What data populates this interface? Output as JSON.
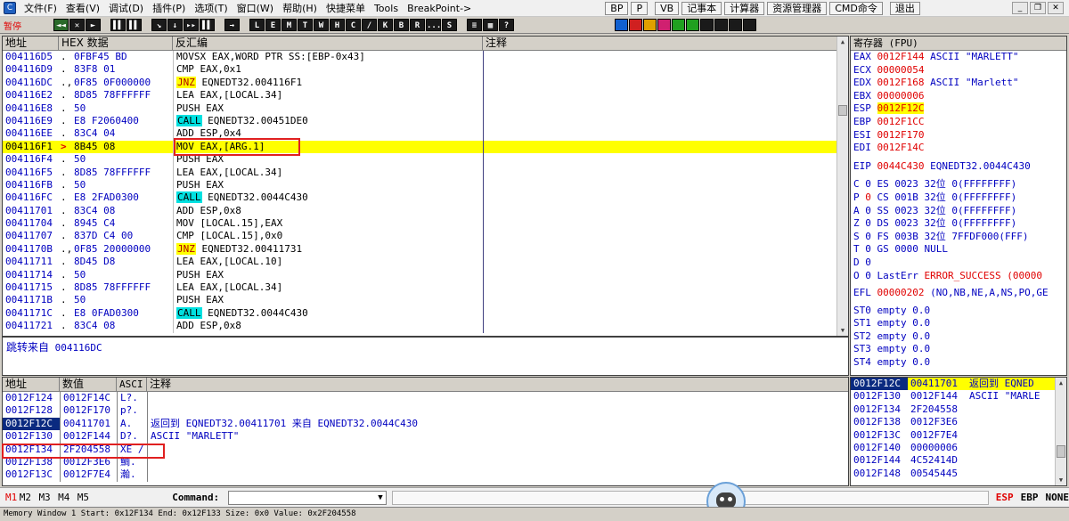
{
  "menu": {
    "items": [
      "文件(F)",
      "查看(V)",
      "调试(D)",
      "插件(P)",
      "选项(T)",
      "窗口(W)",
      "帮助(H)",
      "快捷菜单",
      "Tools",
      "BreakPoint->"
    ],
    "right_buttons": [
      "BP",
      "P",
      "VB",
      "记事本",
      "计算器",
      "资源管理器",
      "CMD命令",
      "退出"
    ]
  },
  "toolbar": {
    "status": "暂停",
    "group1": [
      "◄◄",
      "✕",
      "►"
    ],
    "group2": [
      "▌▌",
      "▌▌",
      "▌▌"
    ],
    "group3": [
      "↘",
      "↓",
      "▸▸"
    ],
    "group4": [
      "→"
    ],
    "letters": [
      "L",
      "E",
      "M",
      "T",
      "W",
      "H",
      "C",
      "/",
      "K",
      "B",
      "R",
      "...",
      "S"
    ],
    "group5": [
      "≡",
      "▦",
      "?"
    ]
  },
  "disasm": {
    "headers": {
      "addr": "地址",
      "hex": "HEX 数据",
      "dis": "反汇编",
      "comment": "注释"
    },
    "rows": [
      {
        "addr": "004116D5",
        "mk": ".",
        "hex": "0FBF45 BD",
        "dis": "MOVSX EAX,WORD PTR SS:[EBP-0x43]",
        "kw": ""
      },
      {
        "addr": "004116D9",
        "mk": ".",
        "hex": "83F8 01",
        "dis": "CMP EAX,0x1",
        "kw": ""
      },
      {
        "addr": "004116DC",
        "mk": ".,",
        "hex": "0F85 0F000000",
        "dis": " EQNEDT32.004116F1",
        "kw": "JNZ"
      },
      {
        "addr": "004116E2",
        "mk": ".",
        "hex": "8D85 78FFFFFF",
        "dis": "LEA EAX,[LOCAL.34]",
        "kw": ""
      },
      {
        "addr": "004116E8",
        "mk": ".",
        "hex": "50",
        "dis": "PUSH EAX",
        "kw": ""
      },
      {
        "addr": "004116E9",
        "mk": ".",
        "hex": "E8 F2060400",
        "dis": " EQNEDT32.00451DE0",
        "kw": "CALL"
      },
      {
        "addr": "004116EE",
        "mk": ".",
        "hex": "83C4 04",
        "dis": "ADD ESP,0x4",
        "kw": ""
      },
      {
        "addr": "004116F1",
        "mk": ">",
        "hex": "8B45 08",
        "dis": "MOV EAX,[ARG.1]",
        "kw": "",
        "sel": true
      },
      {
        "addr": "004116F4",
        "mk": ".",
        "hex": "50",
        "dis": "PUSH EAX",
        "kw": ""
      },
      {
        "addr": "004116F5",
        "mk": ".",
        "hex": "8D85 78FFFFFF",
        "dis": "LEA EAX,[LOCAL.34]",
        "kw": ""
      },
      {
        "addr": "004116FB",
        "mk": ".",
        "hex": "50",
        "dis": "PUSH EAX",
        "kw": ""
      },
      {
        "addr": "004116FC",
        "mk": ".",
        "hex": "E8 2FAD0300",
        "dis": " EQNEDT32.0044C430",
        "kw": "CALL"
      },
      {
        "addr": "00411701",
        "mk": ".",
        "hex": "83C4 08",
        "dis": "ADD ESP,0x8",
        "kw": ""
      },
      {
        "addr": "00411704",
        "mk": ".",
        "hex": "8945 C4",
        "dis": "MOV [LOCAL.15],EAX",
        "kw": ""
      },
      {
        "addr": "00411707",
        "mk": ".",
        "hex": "837D C4 00",
        "dis": "CMP [LOCAL.15],0x0",
        "kw": ""
      },
      {
        "addr": "0041170B",
        "mk": ".,",
        "hex": "0F85 20000000",
        "dis": " EQNEDT32.00411731",
        "kw": "JNZ"
      },
      {
        "addr": "00411711",
        "mk": ".",
        "hex": "8D45 D8",
        "dis": "LEA EAX,[LOCAL.10]",
        "kw": ""
      },
      {
        "addr": "00411714",
        "mk": ".",
        "hex": "50",
        "dis": "PUSH EAX",
        "kw": ""
      },
      {
        "addr": "00411715",
        "mk": ".",
        "hex": "8D85 78FFFFFF",
        "dis": "LEA EAX,[LOCAL.34]",
        "kw": ""
      },
      {
        "addr": "0041171B",
        "mk": ".",
        "hex": "50",
        "dis": "PUSH EAX",
        "kw": ""
      },
      {
        "addr": "0041171C",
        "mk": ".",
        "hex": "E8 0FAD0300",
        "dis": " EQNEDT32.0044C430",
        "kw": "CALL"
      },
      {
        "addr": "00411721",
        "mk": ".",
        "hex": "83C4 08",
        "dis": "ADD ESP,0x8",
        "kw": ""
      }
    ]
  },
  "info": {
    "label": "跳转来自",
    "value": "004116DC"
  },
  "registers": {
    "title": "寄存器 (FPU)",
    "gp": [
      {
        "name": "EAX",
        "val": "0012F144",
        "note": "ASCII \"MARLETT\""
      },
      {
        "name": "ECX",
        "val": "00000054",
        "note": ""
      },
      {
        "name": "EDX",
        "val": "0012F168",
        "note": "ASCII \"Marlett\""
      },
      {
        "name": "EBX",
        "val": "00000006",
        "note": ""
      },
      {
        "name": "ESP",
        "val": "0012F12C",
        "note": "",
        "hl": true
      },
      {
        "name": "EBP",
        "val": "0012F1CC",
        "note": ""
      },
      {
        "name": "ESI",
        "val": "0012F170",
        "note": ""
      },
      {
        "name": "EDI",
        "val": "0012F14C",
        "note": ""
      }
    ],
    "eip": {
      "name": "EIP",
      "val": "0044C430",
      "note": "EQNEDT32.0044C430"
    },
    "flags": [
      {
        "f": "C",
        "v": "0",
        "seg": "ES",
        "sv": "0023",
        "bits": "32位",
        "base": "0(FFFFFFFF)"
      },
      {
        "f": "P",
        "v": "0",
        "seg": "CS",
        "sv": "001B",
        "bits": "32位",
        "base": "0(FFFFFFFF)",
        "red": true
      },
      {
        "f": "A",
        "v": "0",
        "seg": "SS",
        "sv": "0023",
        "bits": "32位",
        "base": "0(FFFFFFFF)"
      },
      {
        "f": "Z",
        "v": "0",
        "seg": "DS",
        "sv": "0023",
        "bits": "32位",
        "base": "0(FFFFFFFF)"
      },
      {
        "f": "S",
        "v": "0",
        "seg": "FS",
        "sv": "003B",
        "bits": "32位",
        "base": "7FFDF000(FFF)"
      },
      {
        "f": "T",
        "v": "0",
        "seg": "GS",
        "sv": "0000",
        "bits": "NULL",
        "base": ""
      },
      {
        "f": "D",
        "v": "0",
        "seg": "",
        "sv": "",
        "bits": "",
        "base": ""
      },
      {
        "f": "O",
        "v": "0",
        "seg": "LastErr",
        "sv": "ERROR_SUCCESS (00000",
        "bits": "",
        "base": ""
      }
    ],
    "efl": {
      "name": "EFL",
      "val": "00000202",
      "note": "(NO,NB,NE,A,NS,PO,GE"
    },
    "fpu": [
      "ST0 empty 0.0",
      "ST1 empty 0.0",
      "ST2 empty 0.0",
      "ST3 empty 0.0",
      "ST4 empty 0.0"
    ]
  },
  "dump": {
    "headers": {
      "addr": "地址",
      "val": "数值",
      "ascii": "ASCI",
      "comment": "注释"
    },
    "rows": [
      {
        "addr": "0012F124",
        "val": "0012F14C",
        "ascii": "L?.",
        "comment": ""
      },
      {
        "addr": "0012F128",
        "val": "0012F170",
        "ascii": "p?.",
        "comment": ""
      },
      {
        "addr": "0012F12C",
        "val": "00411701",
        "ascii": "A.",
        "comment": "返回到 EQNEDT32.00411701 来自 EQNEDT32.0044C430",
        "sel": true
      },
      {
        "addr": "0012F130",
        "val": "0012F144",
        "ascii": "D?.",
        "comment": "ASCII \"MARLETT\""
      },
      {
        "addr": "0012F134",
        "val": "2F204558",
        "ascii": "XE /",
        "comment": ""
      },
      {
        "addr": "0012F138",
        "val": "0012F3E6",
        "ascii": "鯛.",
        "comment": ""
      },
      {
        "addr": "0012F13C",
        "val": "0012F7E4",
        "ascii": "瀚.",
        "comment": ""
      }
    ]
  },
  "stack": {
    "top": {
      "addr": "0012F12C",
      "val": "00411701",
      "note": "返回到 EQNED"
    },
    "rows": [
      {
        "addr": "0012F130",
        "val": "0012F144",
        "note": "ASCII \"MARLE"
      },
      {
        "addr": "0012F134",
        "val": "2F204558",
        "note": ""
      },
      {
        "addr": "0012F138",
        "val": "0012F3E6",
        "note": ""
      },
      {
        "addr": "0012F13C",
        "val": "0012F7E4",
        "note": ""
      },
      {
        "addr": "0012F140",
        "val": "00000006",
        "note": ""
      },
      {
        "addr": "0012F144",
        "val": "4C52414D",
        "note": ""
      },
      {
        "addr": "0012F148",
        "val": "00545445",
        "note": ""
      }
    ]
  },
  "command": {
    "marks": [
      "M1",
      "M2",
      "M3",
      "M4",
      "M5"
    ],
    "label": "Command:",
    "regs": [
      "ESP",
      "EBP",
      "NONE"
    ]
  },
  "statusbar": "Memory Window 1  Start: 0x12F134  End: 0x12F133  Size: 0x0 Value: 0x2F204558"
}
